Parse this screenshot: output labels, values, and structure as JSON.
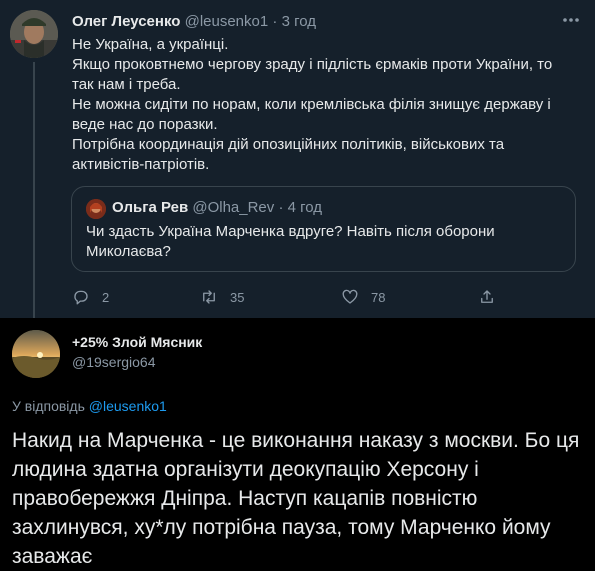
{
  "colors": {
    "accent": "#1d9bf0",
    "dim_bg": "#15202b",
    "black_bg": "#000000",
    "secondary_text": "#8b98a5"
  },
  "tweet": {
    "author_name": "Олег Леусенко",
    "handle": "@leusenko1",
    "separator": "·",
    "time": "3 год",
    "more_icon": "more-horizontal-icon",
    "lines": [
      "Не Україна, а українці.",
      "Якщо проковтнемо чергову зраду і підлість єрмаків проти України, то так нам і треба.",
      "Не можна сидіти по норам, коли кремлівська філія знищує державу і веде нас до поразки.",
      "Потрібна координація дій опозиційних політиків, військових та активістів-патріотів."
    ],
    "quoted": {
      "author_name": "Ольга Рев",
      "handle": "@Olha_Rev",
      "separator": "·",
      "time": "4 год",
      "text": "Чи здасть Україна Марченка вдруге? Навіть після оборони Миколаєва?"
    },
    "actions": {
      "reply_count": "2",
      "retweet_count": "35",
      "like_count": "78"
    }
  },
  "reply": {
    "author_name": "+25% Злой Мясник",
    "handle": "@19sergio64",
    "replying_prefix": "У відповідь",
    "replying_to": "@leusenko1",
    "text": "Накид на Марченка - це виконання наказу з москви. Бо ця  людина здатна організути деокупацію Херсону і правобережжя Дніпра. Наступ кацапів повністю захлинувся, ху*лу потрібна пауза, тому Марченко йому заважає"
  }
}
